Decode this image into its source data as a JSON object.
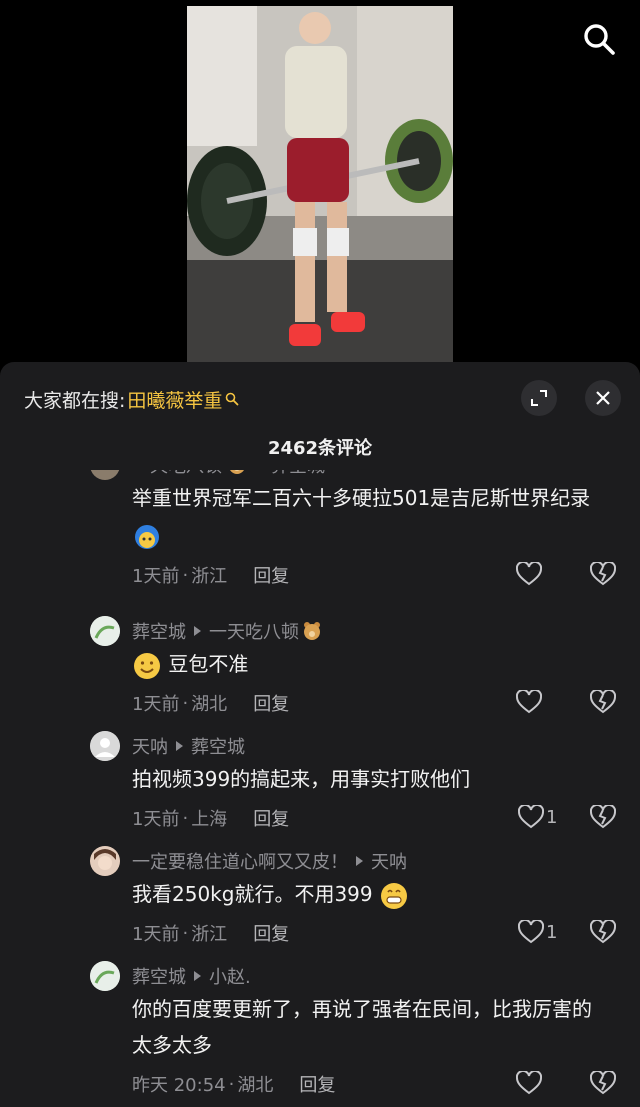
{
  "top": {
    "search_icon": "search-icon"
  },
  "panel": {
    "hot_label": "大家都在搜:",
    "hot_keyword": "田曦薇举重",
    "comment_count": "2462条评论"
  },
  "comments": [
    {
      "author": "一天吃八顿",
      "reply_to": "葬空城",
      "text": "举重世界冠军二百六十多硬拉501是吉尼斯世界纪录",
      "time": "1天前",
      "location": "浙江",
      "reply_label": "回复",
      "likes": ""
    },
    {
      "author": "葬空城",
      "reply_to": "一天吃八顿",
      "text": "豆包不准",
      "time": "1天前",
      "location": "湖北",
      "reply_label": "回复",
      "likes": ""
    },
    {
      "author": "天呐",
      "reply_to": "葬空城",
      "text": "拍视频399的搞起来，用事实打败他们",
      "time": "1天前",
      "location": "上海",
      "reply_label": "回复",
      "likes": "1"
    },
    {
      "author": "一定要稳住道心啊又又皮！",
      "reply_to": "天呐",
      "text": "我看250kg就行。不用399",
      "time": "1天前",
      "location": "浙江",
      "reply_label": "回复",
      "likes": "1"
    },
    {
      "author": "葬空城",
      "reply_to": "小赵.",
      "text": "你的百度要更新了，再说了强者在民间，比我厉害的太多太多",
      "time": "昨天 20:54",
      "location": "湖北",
      "reply_label": "回复",
      "likes": ""
    }
  ],
  "separator": "·",
  "colors": {
    "panel_bg": "#1c1c1e",
    "keyword": "#f5c441",
    "muted": "#8e8e93"
  }
}
